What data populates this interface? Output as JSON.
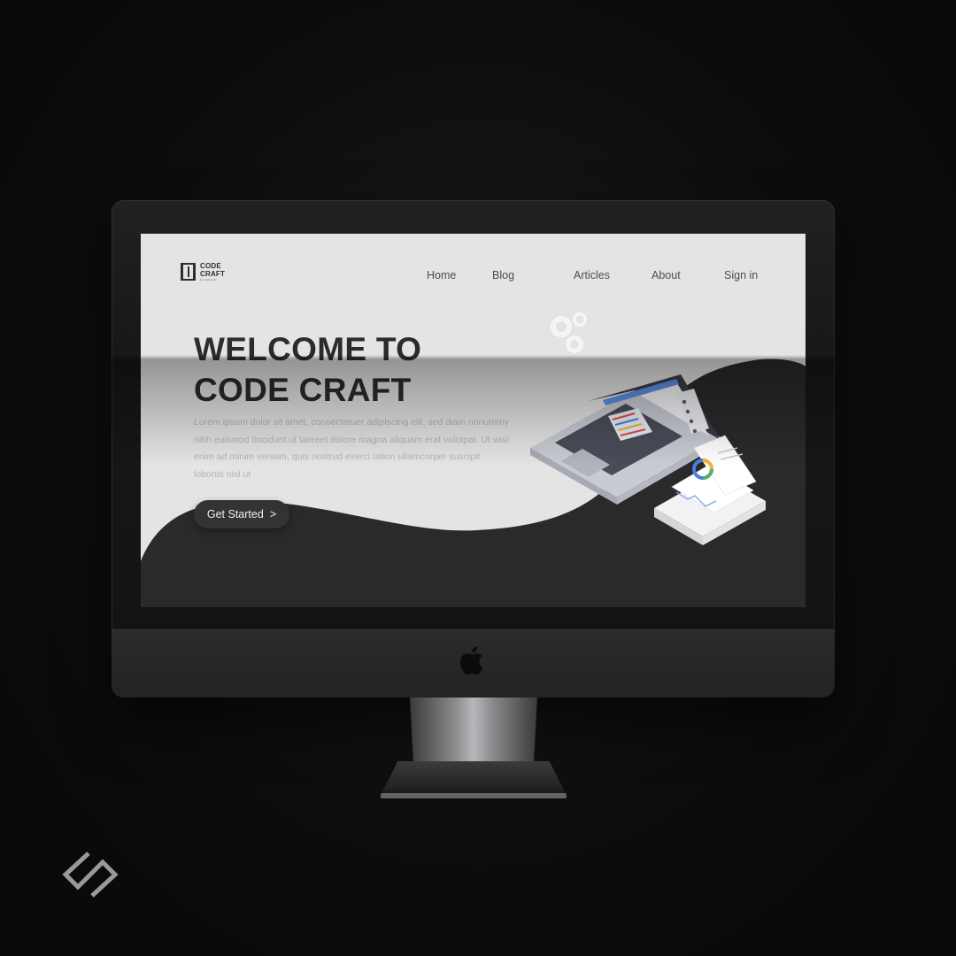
{
  "site": {
    "logo_line1": "CODE",
    "logo_line2": "CRAFT",
    "logo_tagline": "by craftcode"
  },
  "nav": {
    "items": [
      {
        "label": "Home"
      },
      {
        "label": "Blog"
      },
      {
        "label": "Articles"
      },
      {
        "label": "About"
      },
      {
        "label": "Sign in"
      }
    ]
  },
  "hero": {
    "title_line1": "WELCOME TO",
    "title_line2": "CODE CRAFT",
    "body": "Lorem ipsum dolor sit amet, consectetuer adipiscing elit, sed diam nonummy nibh euismod tincidunt ut laoreet dolore magna aliquam erat volutpat. Ut wisi enim ad minim veniam, quis nostrud exerci tation ullamcorper suscipit lobortis nisl ut",
    "cta_label": "Get Started",
    "cta_arrow": ">"
  },
  "icons": {
    "device_logo": "apple-logo-icon",
    "illustration": "isometric-laptop-illustration",
    "gears": "gears-icon",
    "brand": "brand-mark-icon"
  },
  "colors": {
    "page_background": "#0d0d0e",
    "screen_background": "#e4e4e5",
    "wave": "#2a2a2b",
    "title": "#2b2b2c",
    "cta_background": "#333335"
  }
}
